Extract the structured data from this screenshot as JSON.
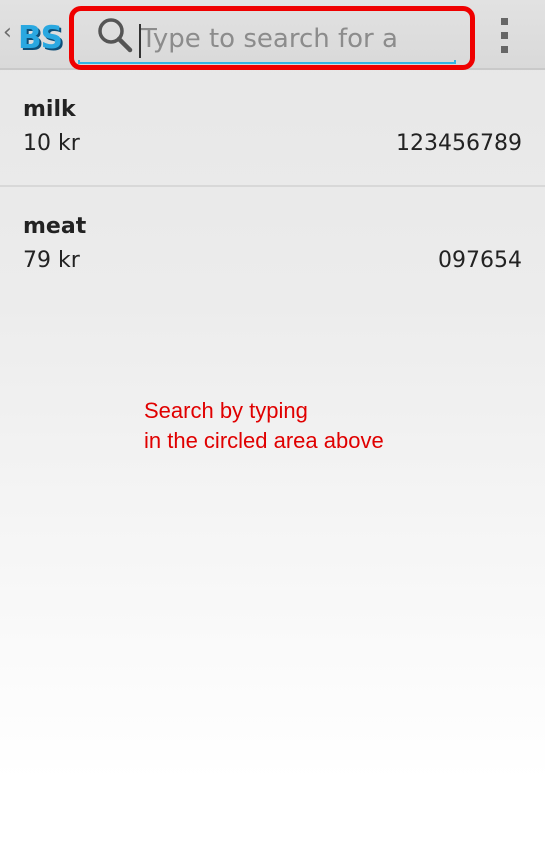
{
  "app": {
    "logo_text": "BS",
    "accent_color": "#2aa8e0"
  },
  "search": {
    "placeholder": "Type to search for a product",
    "value": "",
    "icon": "search-icon",
    "highlight_color": "#ef0000"
  },
  "menu": {
    "icon": "overflow-menu-icon"
  },
  "products": [
    {
      "name": "milk",
      "price": "10 kr",
      "code": "123456789"
    },
    {
      "name": "meat",
      "price": "79 kr",
      "code": "097654"
    }
  ],
  "annotation": {
    "line1": "Search by typing",
    "line2": "in the circled area above",
    "color": "#e00000"
  }
}
